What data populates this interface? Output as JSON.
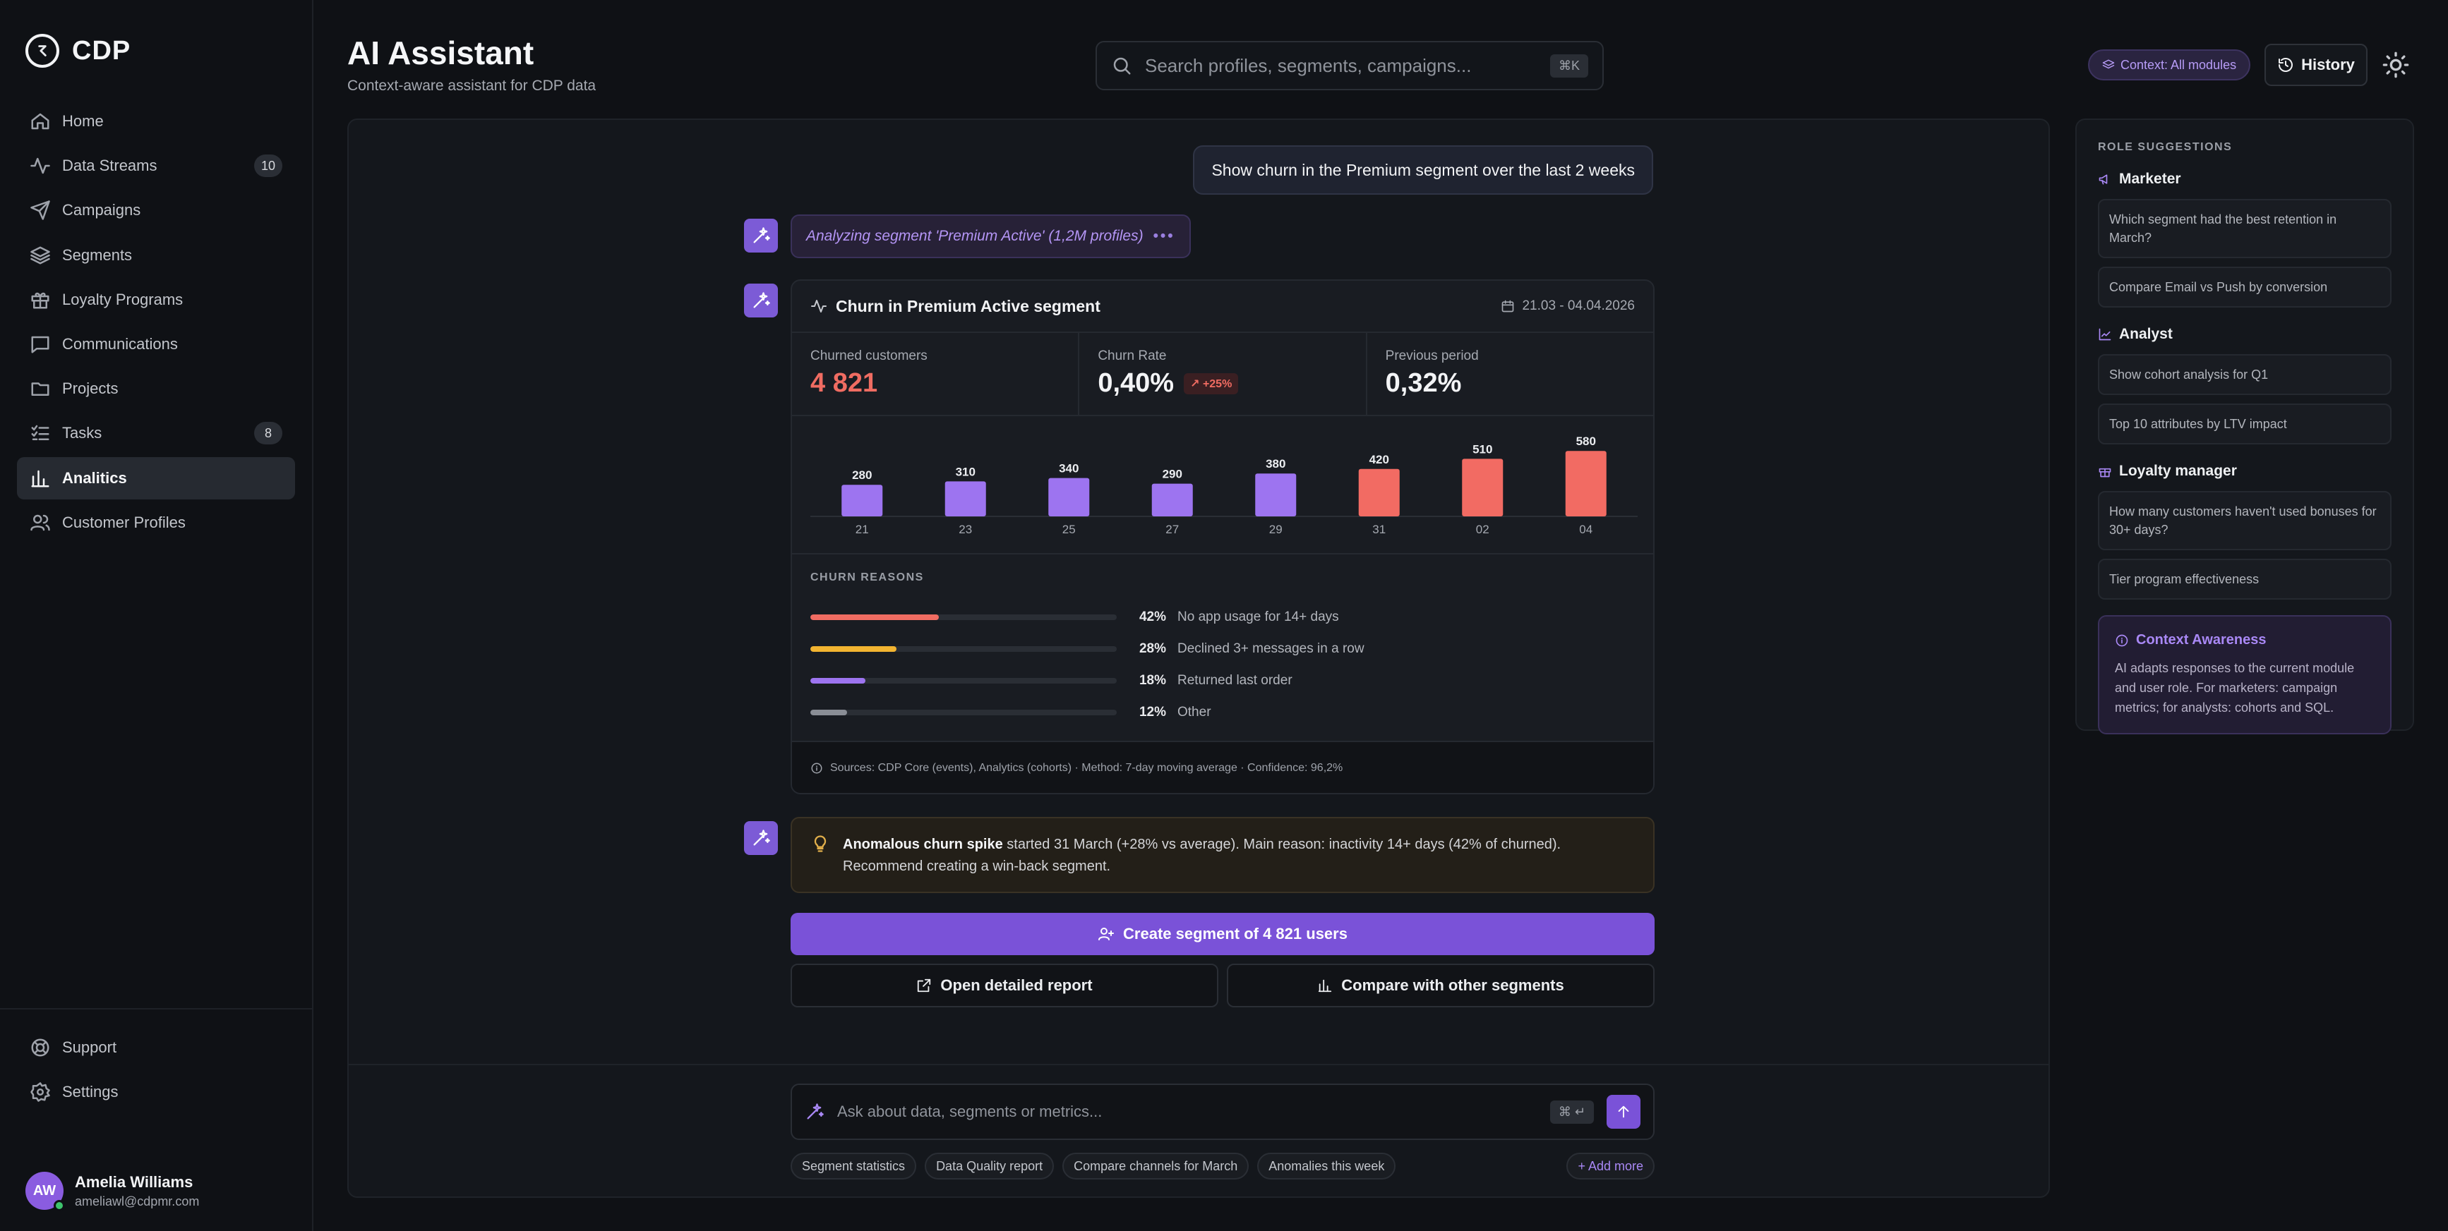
{
  "app": {
    "logo_text": "CDP"
  },
  "sidebar": {
    "items": [
      {
        "label": "Home",
        "icon": "home-icon"
      },
      {
        "label": "Data Streams",
        "icon": "activity-icon",
        "badge": "10"
      },
      {
        "label": "Campaigns",
        "icon": "send-icon"
      },
      {
        "label": "Segments",
        "icon": "layers-icon"
      },
      {
        "label": "Loyalty Programs",
        "icon": "gift-icon"
      },
      {
        "label": "Communications",
        "icon": "message-icon"
      },
      {
        "label": "Projects",
        "icon": "folder-icon"
      },
      {
        "label": "Tasks",
        "icon": "tasks-icon",
        "badge": "8"
      },
      {
        "label": "Analitics",
        "icon": "bar-chart-icon",
        "active": true
      },
      {
        "label": "Customer Profiles",
        "icon": "users-icon"
      }
    ],
    "bottom": [
      {
        "label": "Support",
        "icon": "help-icon"
      },
      {
        "label": "Settings",
        "icon": "gear-icon"
      }
    ],
    "user": {
      "initials": "AW",
      "name": "Amelia Williams",
      "email": "ameliawl@cdpmr.com",
      "status": "online"
    }
  },
  "header": {
    "title": "AI Assistant",
    "subtitle": "Context-aware assistant for CDP data",
    "search_placeholder": "Search profiles, segments, campaigns...",
    "search_shortcut": "⌘K",
    "context_chip": "Context: All modules",
    "history_label": "History"
  },
  "chat": {
    "user_message": "Show churn in the Premium segment over the last 2 weeks",
    "thinking_text": "Analyzing segment 'Premium Active' (1,2M profiles)",
    "card": {
      "title": "Churn in Premium Active segment",
      "date_range": "21.03 - 04.04.2026",
      "metrics": [
        {
          "label": "Churned customers",
          "value": "4 821",
          "tone": "red"
        },
        {
          "label": "Churn Rate",
          "value": "0,40%",
          "delta": "+25%"
        },
        {
          "label": "Previous period",
          "value": "0,32%"
        }
      ],
      "reasons_title": "CHURN REASONS",
      "reasons": [
        {
          "pct": "42%",
          "value": 42,
          "text": "No app usage for 14+ days",
          "color": "#f06c62"
        },
        {
          "pct": "28%",
          "value": 28,
          "text": "Declined 3+ messages in a row",
          "color": "#f2b431"
        },
        {
          "pct": "18%",
          "value": 18,
          "text": "Returned last order",
          "color": "#9d74f0"
        },
        {
          "pct": "12%",
          "value": 12,
          "text": "Other",
          "color": "#8a8e96"
        }
      ],
      "footer": "Sources: CDP Core (events), Analytics (cohorts) · Method: 7-day moving average · Confidence: 96,2%"
    },
    "insight": {
      "bold": "Anomalous churn spike",
      "text": " started 31 March (+28% vs average). Main reason: inactivity 14+ days (42% of churned). Recommend creating a win-back segment."
    },
    "cta_label": "Create segment of 4 821 users",
    "secondary_buttons": [
      "Open detailed report",
      "Compare with other segments"
    ],
    "input_placeholder": "Ask about data, segments or metrics...",
    "input_shortcut": "⌘ ↵",
    "quick_chips": [
      "Segment statistics",
      "Data Quality report",
      "Compare channels for March",
      "Anomalies this week"
    ],
    "add_more_label": "+ Add more"
  },
  "chart_data": {
    "type": "bar",
    "categories": [
      "21",
      "23",
      "25",
      "27",
      "29",
      "31",
      "02",
      "04"
    ],
    "values": [
      280,
      310,
      340,
      290,
      380,
      420,
      510,
      580
    ],
    "highlight_from_index": 5,
    "colors": {
      "normal": "#9d74f0",
      "highlight": "#f26b63"
    },
    "ylim": [
      0,
      600
    ]
  },
  "right_panel": {
    "title": "ROLE SUGGESTIONS",
    "roles": [
      {
        "name": "Marketer",
        "icon": "megaphone-icon",
        "suggestions": [
          "Which segment had the best retention in March?",
          "Compare Email vs Push by conversion"
        ]
      },
      {
        "name": "Analyst",
        "icon": "trend-icon",
        "suggestions": [
          "Show cohort analysis for Q1",
          "Top 10 attributes by LTV impact"
        ]
      },
      {
        "name": "Loyalty manager",
        "icon": "gift-icon",
        "suggestions": [
          "How many customers haven't used bonuses for 30+ days?",
          "Tier program effectiveness"
        ]
      }
    ],
    "context_awareness": {
      "title": "Context Awareness",
      "text": "AI adapts responses to the current module and user role. For marketers: campaign metrics; for analysts: cohorts and SQL."
    }
  },
  "colors": {
    "accent": "#7a52d8",
    "danger": "#f06c62",
    "warning": "#f2b431"
  }
}
